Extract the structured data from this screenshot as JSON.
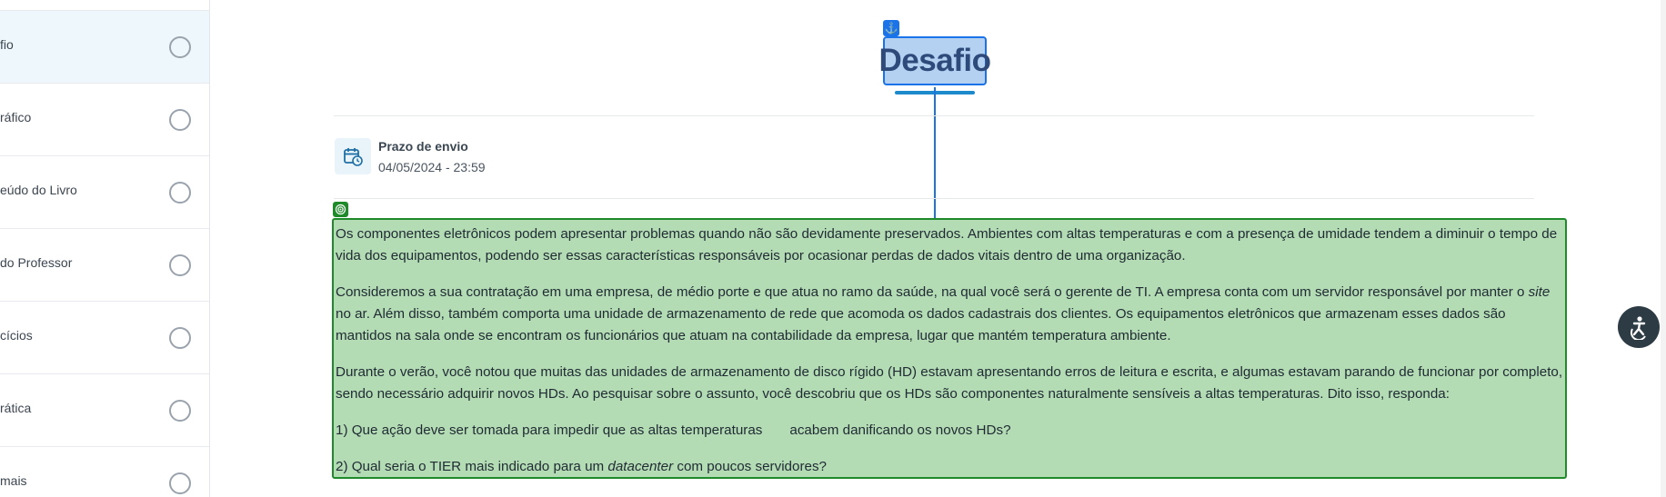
{
  "sidebar": {
    "items": [
      {
        "label": "fio",
        "active": true
      },
      {
        "label": "ráfico",
        "active": false
      },
      {
        "label": "eúdo do Livro",
        "active": false
      },
      {
        "label": "do Professor",
        "active": false
      },
      {
        "label": "cícios",
        "active": false
      },
      {
        "label": "rática",
        "active": false
      },
      {
        "label": "mais",
        "active": false
      }
    ]
  },
  "main": {
    "title": "Desafio",
    "deadline": {
      "label": "Prazo de envio",
      "value": "04/05/2024 - 23:59"
    },
    "content": {
      "p1": "Os componentes eletrônicos podem apresentar problemas quando não são devidamente preservados. Ambientes com altas temperaturas e com a presença de umidade tendem a diminuir o tempo de vida dos equipamentos, podendo ser essas características responsáveis por ocasionar perdas de dados vitais dentro de uma organização.",
      "p2_start": "Consideremos a sua contratação em uma empresa, de médio porte e que atua no ramo da saúde, na qual você será o gerente de TI. A empresa conta com um servidor responsável por manter o ",
      "p2_italic": "site",
      "p2_end": " no ar. Além disso, também comporta uma unidade de armazenamento de rede que acomoda os dados cadastrais dos clientes. Os equipamentos eletrônicos que armazenam esses dados são mantidos na sala onde se encontram os funcionários que atuam na contabilidade da empresa, lugar que mantém temperatura ambiente.",
      "p3": "Durante o verão, você notou que muitas das unidades de armazenamento de disco rígido (HD) estavam apresentando erros de leitura e escrita, e algumas estavam parando de funcionar por completo, sendo necessário adquirir novos HDs. Ao pesquisar sobre o assunto, você descobriu que os HDs são componentes naturalmente sensíveis a  altas temperaturas. Dito isso, responda:",
      "q1_start": "1) Que ação deve ser tomada para impedir que as altas temperaturas",
      "q1_end": "acabem danificando os novos HDs?",
      "q2_start": "2) Qual seria o TIER mais indicado para um ",
      "q2_italic": "datacenter",
      "q2_end": " com poucos servidores?"
    }
  },
  "icons": {
    "anchor": "anchor-icon",
    "calendar": "calendar-clock-icon",
    "target": "target-icon",
    "accessibility": "accessibility-icon"
  },
  "colors": {
    "title_highlight_bg": "#b4d1f2",
    "title_highlight_border": "#1a73e8",
    "content_highlight_bg": "#b4dcb4",
    "content_highlight_border": "#1f8a2a",
    "sidebar_active_bg": "#eef7fc"
  }
}
